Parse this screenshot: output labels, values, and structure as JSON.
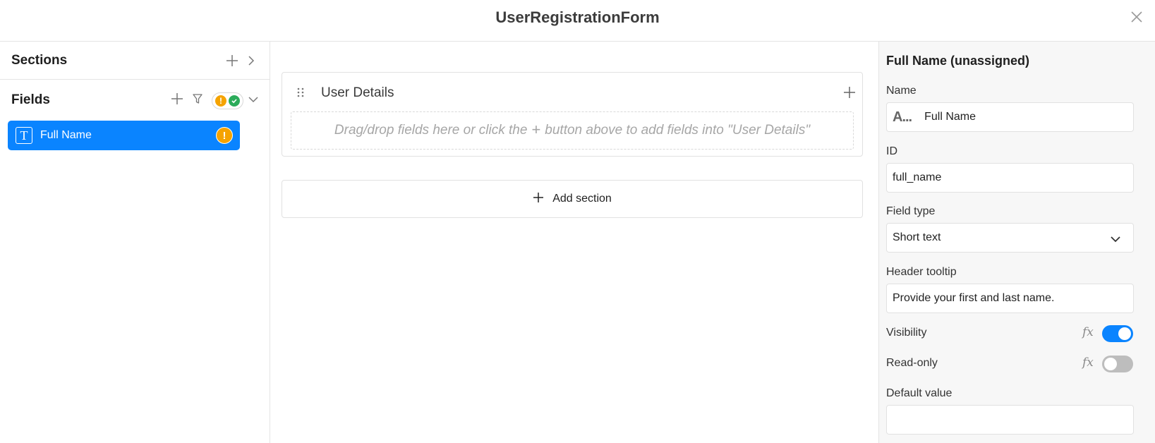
{
  "window": {
    "title": "UserRegistrationForm"
  },
  "left_panel": {
    "sections_label": "Sections",
    "fields_label": "Fields",
    "fields": [
      {
        "label": "Full Name",
        "type_icon": "T",
        "status": "warning"
      }
    ]
  },
  "center": {
    "section": {
      "title": "User Details",
      "drop_hint_prefix": "Drag/drop fields here or click the",
      "drop_hint_plus": "+",
      "drop_hint_suffix": "button above to add fields into \"User Details\""
    },
    "add_section_label": "Add section"
  },
  "properties": {
    "title": "Full Name (unassigned)",
    "name_label": "Name",
    "name_type_icon": "A...",
    "name_value": "Full Name",
    "id_label": "ID",
    "id_value": "full_name",
    "field_type_label": "Field type",
    "field_type_value": "Short text",
    "tooltip_label": "Header tooltip",
    "tooltip_value": "Provide your first and last name.",
    "visibility_label": "Visibility",
    "visibility_on": true,
    "readonly_label": "Read-only",
    "readonly_on": false,
    "default_label": "Default value",
    "default_value": "",
    "fx_symbol": "fx"
  },
  "colors": {
    "accent": "#0a84ff",
    "warning": "#f5a300",
    "success": "#2bab5a"
  }
}
